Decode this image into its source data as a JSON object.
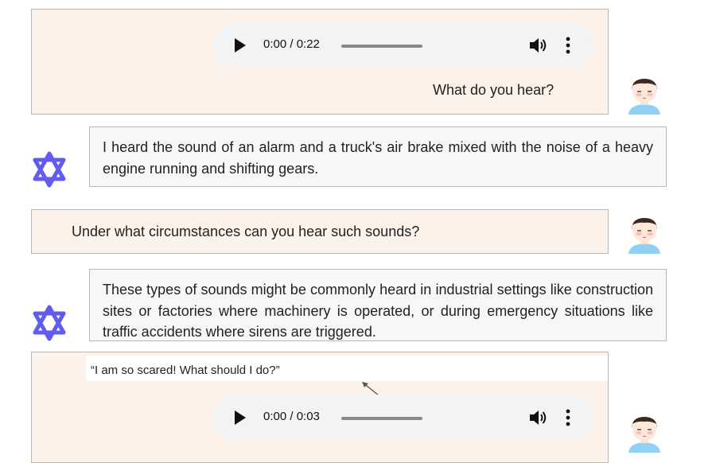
{
  "messages": {
    "m1": {
      "audio": {
        "time": "0:00 / 0:22"
      },
      "text": "What do you hear?"
    },
    "m2": {
      "text": "I heard the sound of an alarm and a truck's air brake mixed with the noise of a heavy engine running and shifting gears."
    },
    "m3": {
      "text": "Under what circumstances can you hear such sounds?"
    },
    "m4": {
      "text": "These types of sounds might be commonly heard in industrial settings like construction sites or factories where machinery is operated, or during emergency situations like traffic accidents where sirens are triggered."
    },
    "m5": {
      "quote": "“I am so scared! What should I do?”",
      "audio": {
        "time": "0:00 / 0:03"
      }
    }
  },
  "icons": {
    "play": "play-icon",
    "volume": "volume-icon",
    "more": "more-vertical-icon",
    "user_avatar": "user-avatar",
    "assistant_logo": "assistant-logo"
  },
  "colors": {
    "user_bubble": "#fcf2e9",
    "assistant_bubble": "#f7f7f9",
    "logo": "#615ced",
    "avatar_shirt": "#8fd1f5"
  }
}
